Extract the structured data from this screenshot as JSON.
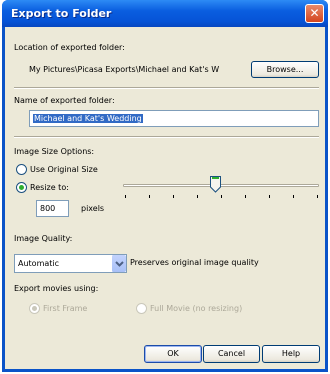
{
  "window": {
    "title": "Export to Folder",
    "close_glyph": "✕"
  },
  "location": {
    "label": "Location of exported folder:",
    "path": "My Pictures\\Picasa Exports\\Michael and Kat's W",
    "browse_label": "Browse..."
  },
  "name": {
    "label": "Name of exported folder:",
    "value": "Michael and Kat's Wedding"
  },
  "image_size": {
    "label": "Image Size Options:",
    "use_original_label": "Use Original Size",
    "resize_label": "Resize to:",
    "selected": "resize",
    "pixels_value": "800",
    "pixels_unit": "pixels",
    "slider_fraction": 0.47
  },
  "quality": {
    "label": "Image Quality:",
    "selected": "Automatic",
    "description": "Preserves original image quality"
  },
  "movies": {
    "label": "Export movies using:",
    "first_frame_label": "First Frame",
    "full_movie_label": "Full Movie (no resizing)",
    "selected": "first_frame",
    "enabled": false
  },
  "buttons": {
    "ok": "OK",
    "cancel": "Cancel",
    "help": "Help"
  },
  "colors": {
    "titlebar": "#0a5ee0",
    "dialog_bg": "#ece9d8",
    "selection": "#316ac5",
    "radio_dot": "#2fae2f",
    "close": "#d4451f"
  }
}
